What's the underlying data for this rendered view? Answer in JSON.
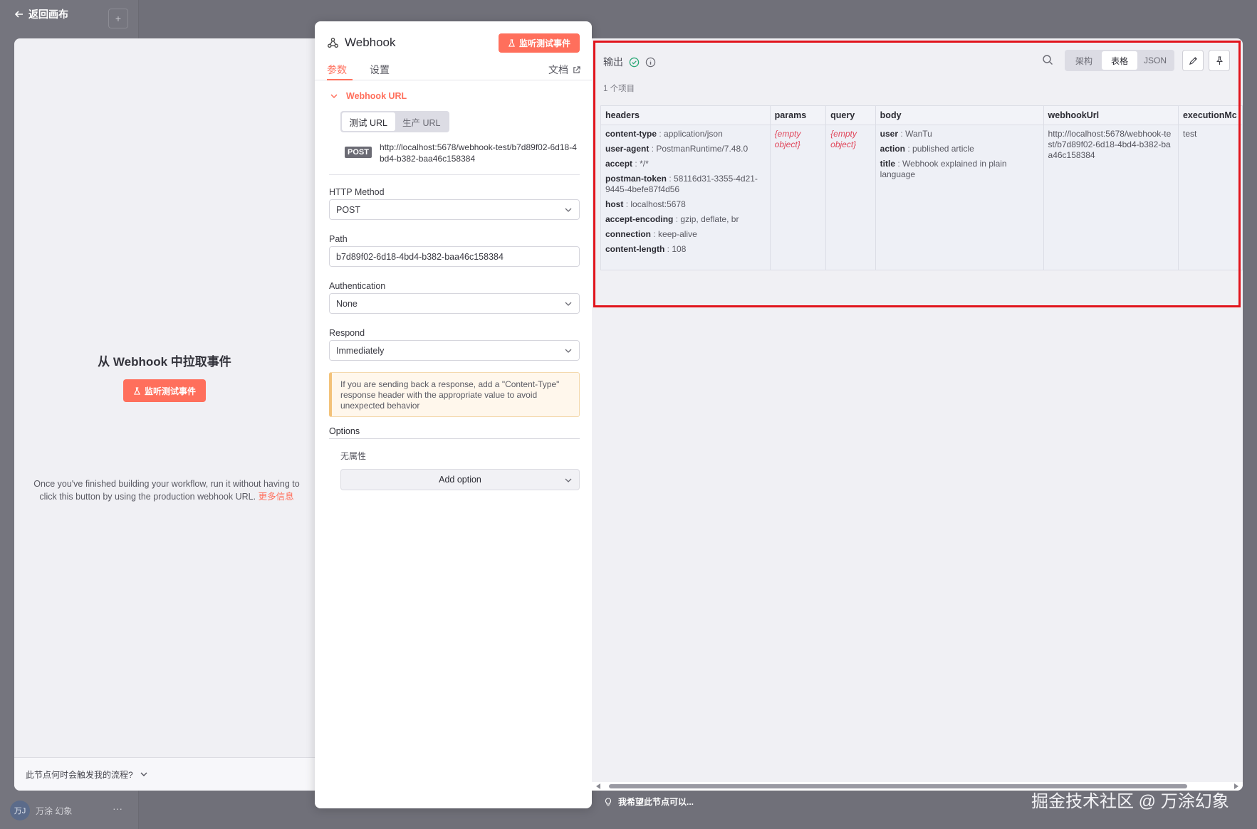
{
  "app": {
    "back_label": "返回画布",
    "add_label": "+",
    "user_avatar": "万J",
    "user_name": "万涂 幻象",
    "user_more": "···"
  },
  "input_panel": {
    "title": "从 Webhook 中拉取事件",
    "listen_button": "监听测试事件",
    "help_text": "Once you've finished building your workflow, run it without having to click this button by using the production webhook URL.",
    "more_link": "更多信息",
    "footer_question": "此节点何时会触发我的流程?"
  },
  "param_panel": {
    "node_name": "Webhook",
    "listen_button": "监听测试事件",
    "tabs": [
      {
        "label": "参数",
        "active": true
      },
      {
        "label": "设置",
        "active": false
      }
    ],
    "docs_label": "文档",
    "webhook_url_section": "Webhook URL",
    "url_toggle": [
      {
        "label": "测试 URL",
        "active": true
      },
      {
        "label": "生产 URL",
        "active": false
      }
    ],
    "method_badge": "POST",
    "webhook_url": "http://localhost:5678/webhook-test/b7d89f02-6d18-4bd4-b382-baa46c158384",
    "fields": {
      "http_method": {
        "label": "HTTP Method",
        "value": "POST"
      },
      "path": {
        "label": "Path",
        "value": "b7d89f02-6d18-4bd4-b382-baa46c158384"
      },
      "authentication": {
        "label": "Authentication",
        "value": "None"
      },
      "respond": {
        "label": "Respond",
        "value": "Immediately"
      }
    },
    "hint": "If you are sending back a response, add a \"Content-Type\" response header with the appropriate value to avoid unexpected behavior",
    "options_label": "Options",
    "no_properties": "无属性",
    "add_option": "Add option"
  },
  "output_panel": {
    "title": "输出",
    "item_count": "1 个项目",
    "view_modes": [
      {
        "label": "架构",
        "active": false
      },
      {
        "label": "表格",
        "active": true
      },
      {
        "label": "JSON",
        "active": false
      }
    ],
    "columns": [
      "headers",
      "params",
      "query",
      "body",
      "webhookUrl",
      "executionMc"
    ],
    "row": {
      "headers": [
        {
          "key": "content-type",
          "value": "application/json"
        },
        {
          "key": "user-agent",
          "value": "PostmanRuntime/7.48.0"
        },
        {
          "key": "accept",
          "value": "*/*"
        },
        {
          "key": "postman-token",
          "value": "58116d31-3355-4d21-9445-4befe87f4d56"
        },
        {
          "key": "host",
          "value": "localhost:5678"
        },
        {
          "key": "accept-encoding",
          "value": "gzip, deflate, br"
        },
        {
          "key": "connection",
          "value": "keep-alive"
        },
        {
          "key": "content-length",
          "value": "108"
        }
      ],
      "params": "{empty object}",
      "query": "{empty object}",
      "body": [
        {
          "key": "user",
          "value": "WanTu"
        },
        {
          "key": "action",
          "value": "published article"
        },
        {
          "key": "title",
          "value": "Webhook explained in plain language"
        }
      ],
      "webhookUrl": "http://localhost:5678/webhook-test/b7d89f02-6d18-4bd4-b382-baa46c158384",
      "executionMode": "test"
    },
    "separator": ":"
  },
  "feedback_label": "我希望此节点可以...",
  "watermark": "掘金技术社区 @ 万涂幻象",
  "colors": {
    "accent": "#ff6f5c",
    "success": "#2aa876",
    "highlight": "#e1141c",
    "empty_object": "#e0465a"
  }
}
